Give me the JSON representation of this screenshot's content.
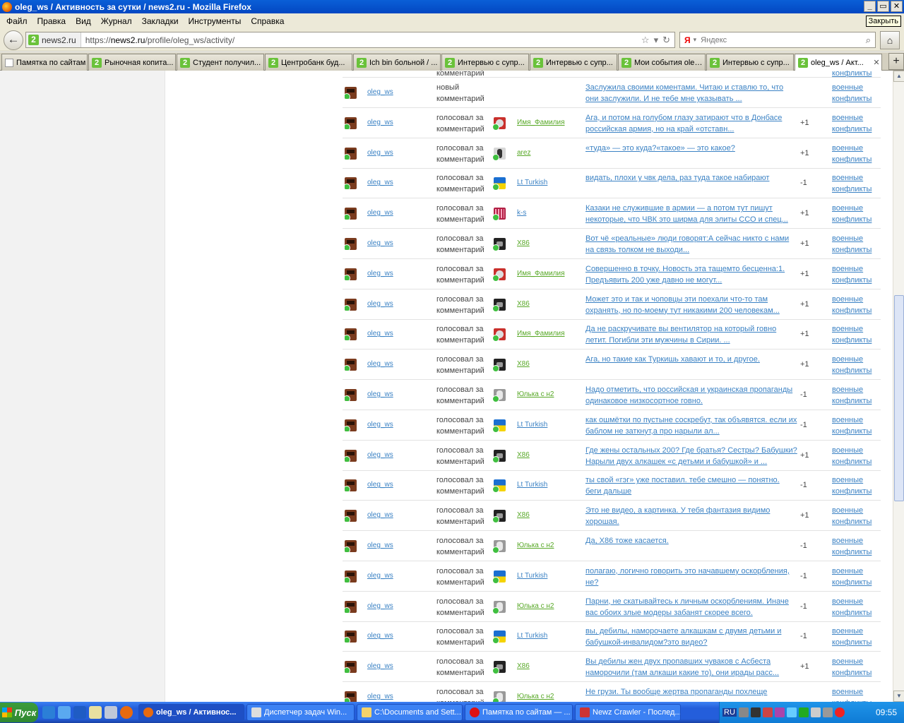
{
  "window": {
    "title": "oleg_ws / Активность за сутки / news2.ru - Mozilla Firefox",
    "close_tooltip": "Закрыть"
  },
  "menu": [
    "Файл",
    "Правка",
    "Вид",
    "Журнал",
    "Закладки",
    "Инструменты",
    "Справка"
  ],
  "nav": {
    "site_badge": "news2.ru",
    "url_prefix": "https://",
    "url_domain": "news2.ru",
    "url_path": "/profile/oleg_ws/activity/",
    "search_placeholder": "Яндекс",
    "search_engine_glyph": "Я"
  },
  "tabs": [
    {
      "label": "Памятка по сайтам",
      "icon": "blank-page-icon"
    },
    {
      "label": "Рыночная копита...",
      "icon": "news2-icon"
    },
    {
      "label": "Студент получил...",
      "icon": "news2-icon"
    },
    {
      "label": "Центробанк буд...",
      "icon": "news2-icon"
    },
    {
      "label": "Ich bin больной / ...",
      "icon": "news2-icon"
    },
    {
      "label": "Интервью с супр...",
      "icon": "news2-icon"
    },
    {
      "label": "Интервью с супр...",
      "icon": "news2-icon"
    },
    {
      "label": "Мои события oleg...",
      "icon": "news2-icon"
    },
    {
      "label": "Интервью с супр...",
      "icon": "news2-icon"
    },
    {
      "label": "oleg_ws / Акт...",
      "icon": "news2-icon",
      "active": true
    }
  ],
  "partial_top_row": {
    "action": "комментарий",
    "category": "конфликты"
  },
  "rows": [
    {
      "user": "oleg_ws",
      "action": "новый комментарий",
      "target_user": "",
      "target_color": "",
      "avatar": "",
      "comment": "Заслужила своими коментами. Читаю и ставлю то, что они заслужили. И не тебе мне указывать ...",
      "score": "",
      "category": "военные конфликты"
    },
    {
      "user": "oleg_ws",
      "action": "голосовал за комментарий",
      "target_user": "Имя_Фамилия",
      "target_color": "green",
      "avatar": "imya",
      "comment": "Ага, и потом на голубом глазу затирают что в Донбасе российская армия, но на край «отставн...",
      "score": "+1",
      "category": "военные конфликты"
    },
    {
      "user": "oleg_ws",
      "action": "голосовал за комментарий",
      "target_user": "arez",
      "target_color": "green",
      "avatar": "arez",
      "comment": "«туда» — это куда?«такое» — это какое?",
      "score": "+1",
      "category": "военные конфликты"
    },
    {
      "user": "oleg_ws",
      "action": "голосовал за комментарий",
      "target_user": "Lt Turkish",
      "target_color": "blue",
      "avatar": "ua",
      "comment": "видать, плохи у чвк дела, раз туда такое набирают",
      "score": "-1",
      "category": "военные конфликты"
    },
    {
      "user": "oleg_ws",
      "action": "голосовал за комментарий",
      "target_user": "k-s",
      "target_color": "blue",
      "avatar": "ks",
      "comment": "Казаки не служившие в армии — а потом тут пишут некоторые, что ЧВК это ширма для элиты ССО и спец...",
      "score": "+1",
      "category": "военные конфликты"
    },
    {
      "user": "oleg_ws",
      "action": "голосовал за комментарий",
      "target_user": "X86",
      "target_color": "green",
      "avatar": "x86",
      "comment": "Вот чё «реальные» люди говорят:А сейчас никто с нами на связь толком не выходи...",
      "score": "+1",
      "category": "военные конфликты"
    },
    {
      "user": "oleg_ws",
      "action": "голосовал за комментарий",
      "target_user": "Имя_Фамилия",
      "target_color": "green",
      "avatar": "imya",
      "comment": "Совершенно в точку. Новость эта тащемто бесценна:1. Предъявить 200 уже давно не могут...",
      "score": "+1",
      "category": "военные конфликты"
    },
    {
      "user": "oleg_ws",
      "action": "голосовал за комментарий",
      "target_user": "X86",
      "target_color": "green",
      "avatar": "x86",
      "comment": "Может это и так и чоповцы эти поехали что-то там охранять, но по-моему тут никакими 200 человекам...",
      "score": "+1",
      "category": "военные конфликты"
    },
    {
      "user": "oleg_ws",
      "action": "голосовал за комментарий",
      "target_user": "Имя_Фамилия",
      "target_color": "green",
      "avatar": "imya",
      "comment": "Да не раскручивате вы вентилятор на который говно летит. Погибли эти мужчины в Сирии. ...",
      "score": "+1",
      "category": "военные конфликты"
    },
    {
      "user": "oleg_ws",
      "action": "голосовал за комментарий",
      "target_user": "X86",
      "target_color": "green",
      "avatar": "x86",
      "comment": "Ага, но такие как Туркишь хавают и то, и другое.",
      "score": "+1",
      "category": "военные конфликты"
    },
    {
      "user": "oleg_ws",
      "action": "голосовал за комментарий",
      "target_user": "Юлька с н2",
      "target_color": "green",
      "avatar": "yulka",
      "comment": "Надо отметить, что российская и украинская пропаганды одинаковое низкосортное говно.",
      "score": "-1",
      "category": "военные конфликты"
    },
    {
      "user": "oleg_ws",
      "action": "голосовал за комментарий",
      "target_user": "Lt Turkish",
      "target_color": "blue",
      "avatar": "ua",
      "comment": "как ошмётки по пустыне соскребут, так объявятся. если их баблом не заткнут,а про нарыли ал...",
      "score": "-1",
      "category": "военные конфликты"
    },
    {
      "user": "oleg_ws",
      "action": "голосовал за комментарий",
      "target_user": "X86",
      "target_color": "green",
      "avatar": "x86",
      "comment": "Где жены остальных 200? Где братья? Сестры? Бабушки? Нарыли двух алкашек «с детьми и бабушкой» и ...",
      "score": "+1",
      "category": "военные конфликты"
    },
    {
      "user": "oleg_ws",
      "action": "голосовал за комментарий",
      "target_user": "Lt Turkish",
      "target_color": "blue",
      "avatar": "ua",
      "comment": "ты свой «гэг» уже поставил. тебе смешно — понятно. беги дальше",
      "score": "-1",
      "category": "военные конфликты"
    },
    {
      "user": "oleg_ws",
      "action": "голосовал за комментарий",
      "target_user": "X86",
      "target_color": "green",
      "avatar": "x86",
      "comment": "Это не видео, а картинка. У тебя фантазия видимо хорошая.",
      "score": "+1",
      "category": "военные конфликты"
    },
    {
      "user": "oleg_ws",
      "action": "голосовал за комментарий",
      "target_user": "Юлька с н2",
      "target_color": "green",
      "avatar": "yulka",
      "comment": "Да, X86 тоже касается.",
      "score": "-1",
      "category": "военные конфликты"
    },
    {
      "user": "oleg_ws",
      "action": "голосовал за комментарий",
      "target_user": "Lt Turkish",
      "target_color": "blue",
      "avatar": "ua",
      "comment": "полагаю, логично говорить это начавшему оскорбления, не?",
      "score": "-1",
      "category": "военные конфликты"
    },
    {
      "user": "oleg_ws",
      "action": "голосовал за комментарий",
      "target_user": "Юлька с н2",
      "target_color": "green",
      "avatar": "yulka",
      "comment": "Парни, не скатывайтесь к личным оскорблениям. Иначе вас обоих злые модеры забанят скорее всего.",
      "score": "-1",
      "category": "военные конфликты"
    },
    {
      "user": "oleg_ws",
      "action": "голосовал за комментарий",
      "target_user": "Lt Turkish",
      "target_color": "blue",
      "avatar": "ua",
      "comment": "вы, дебилы, наморочаете алкашкам с двумя детьми и бабушкой-инвалидом?это видео?",
      "score": "-1",
      "category": "военные конфликты"
    },
    {
      "user": "oleg_ws",
      "action": "голосовал за комментарий",
      "target_user": "X86",
      "target_color": "green",
      "avatar": "x86",
      "comment": "Вы дебилы жен двух пропавших чуваков с Асбеста наморочили (там алкаши какие то), они ирады расс...",
      "score": "+1",
      "category": "военные конфликты"
    },
    {
      "user": "oleg_ws",
      "action": "голосовал за комментарий",
      "target_user": "Юлька с н2",
      "target_color": "green",
      "avatar": "yulka",
      "comment": "Не грузи. Ты вообще жертва пропаганды похлеще",
      "score": "",
      "category": "военные конфликты"
    }
  ],
  "taskbar": {
    "start_label": "Пуск",
    "tasks": [
      {
        "label": "oleg_ws / Активнос...",
        "active": true
      },
      {
        "label": "Диспетчер задач Win..."
      },
      {
        "label": "C:\\Documents and Sett..."
      },
      {
        "label": "Памятка по сайтам — ..."
      },
      {
        "label": "Newz Crawler - Послед..."
      }
    ],
    "lang": "RU",
    "clock": "09:55"
  },
  "colors": {
    "link_blue": "#3b82c4",
    "link_green": "#58a827",
    "taskbar_blue": "#245edb"
  }
}
